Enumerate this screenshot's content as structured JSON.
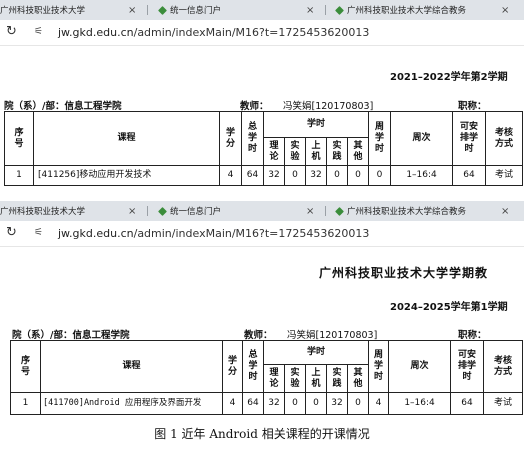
{
  "shot1": {
    "tabs": [
      {
        "title": "广州科技职业技术大学",
        "close": "×"
      },
      {
        "title": "统一信息门户",
        "close": "×"
      },
      {
        "title": "广州科技职业技术大学综合教务",
        "close": "×"
      }
    ],
    "url": {
      "host": "jw.gkd.edu.cn",
      "path": "/admin/indexMain/M16?t=1725453620013"
    },
    "semester": "2021–2022学年第2学期",
    "department_label": "院（系）/部：信息工程学院",
    "teacher_label": "教师：",
    "teacher_name": "冯笑娟[120170803]",
    "title_label": "职称：",
    "row": {
      "no": "1",
      "course": "[411256]移动应用开发技术",
      "credits": "4",
      "total_hours": "64",
      "theory": "32",
      "experiment": "0",
      "computer": "32",
      "practice": "0",
      "other": "0",
      "weekly_hours": "0",
      "weeks": "1–16:4",
      "schedulable": "64",
      "assessment": "考试"
    }
  },
  "shot2": {
    "tabs": [
      {
        "title": "广州科技职业技术大学",
        "close": "×"
      },
      {
        "title": "统一信息门户",
        "close": "×"
      },
      {
        "title": "广州科技职业技术大学综合教务",
        "close": "×"
      }
    ],
    "url": {
      "host": "jw.gkd.edu.cn",
      "path": "/admin/indexMain/M16?t=1725453620013"
    },
    "page_title": "广州科技职业技术大学学期教",
    "semester": "2024–2025学年第1学期",
    "department_label": "院（系）/部：信息工程学院",
    "teacher_label": "教师：",
    "teacher_name": "冯笑娟[120170803]",
    "title_label": "职称：",
    "row": {
      "no": "1",
      "course": "[411700]Android 应用程序及界面开发",
      "credits": "4",
      "total_hours": "64",
      "theory": "32",
      "experiment": "0",
      "computer": "0",
      "practice": "32",
      "other": "0",
      "weekly_hours": "4",
      "weeks": "1–16:4",
      "schedulable": "64",
      "assessment": "考试"
    }
  },
  "headers": {
    "no": "序号",
    "course": "课程",
    "credits": "学分",
    "total_hours": "总学时",
    "hours_group": "学时",
    "theory": "理论",
    "experiment": "实验",
    "computer": "上机",
    "practice": "实践",
    "other": "其他",
    "weekly_hours": "周学时",
    "weeks": "周次",
    "schedulable": "可安排学时",
    "assessment": "考核方式"
  },
  "caption": "图 1  近年 Android 相关课程的开课情况",
  "icons": {
    "reload": "reload-icon",
    "site_info": "site-info-icon",
    "favicon": "portal-favicon-icon"
  }
}
